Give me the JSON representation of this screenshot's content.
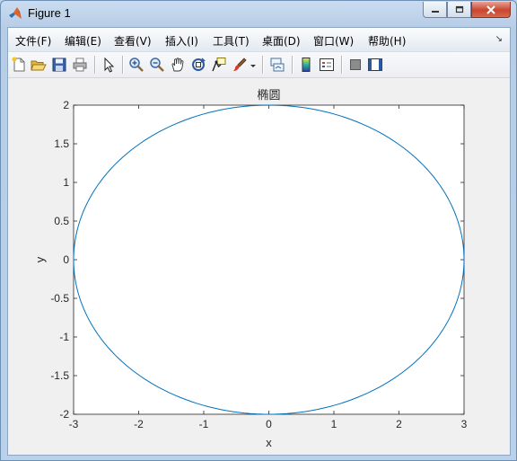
{
  "window": {
    "title": "Figure 1"
  },
  "menubar": {
    "items": [
      "文件(F)",
      "编辑(E)",
      "查看(V)",
      "插入(I)",
      "工具(T)",
      "桌面(D)",
      "窗口(W)",
      "帮助(H)"
    ]
  },
  "toolbar": {
    "icons": [
      "new-figure-icon",
      "open-file-icon",
      "save-icon",
      "print-icon",
      "pointer-icon",
      "zoom-in-icon",
      "zoom-out-icon",
      "pan-hand-icon",
      "rotate-3d-icon",
      "data-cursor-icon",
      "brush-icon",
      "brush-dropdown-icon",
      "link-plot-icon",
      "colorbar-icon",
      "legend-icon",
      "hide-plot-tools-icon",
      "show-plot-tools-icon"
    ]
  },
  "chart_data": {
    "type": "line",
    "title": "椭圆",
    "xlabel": "x",
    "ylabel": "y",
    "xlim": [
      -3,
      3
    ],
    "ylim": [
      -2,
      2
    ],
    "xticks": [
      "-3",
      "-2",
      "-1",
      "0",
      "1",
      "2",
      "3"
    ],
    "yticks": [
      "-2",
      "-1.5",
      "-1",
      "-0.5",
      "0",
      "0.5",
      "1",
      "1.5",
      "2"
    ],
    "grid": false,
    "series": [
      {
        "curve": "x = 3cos(t), y = 2sin(t), t in [0, 2π]",
        "color": "#0072bd"
      }
    ]
  }
}
